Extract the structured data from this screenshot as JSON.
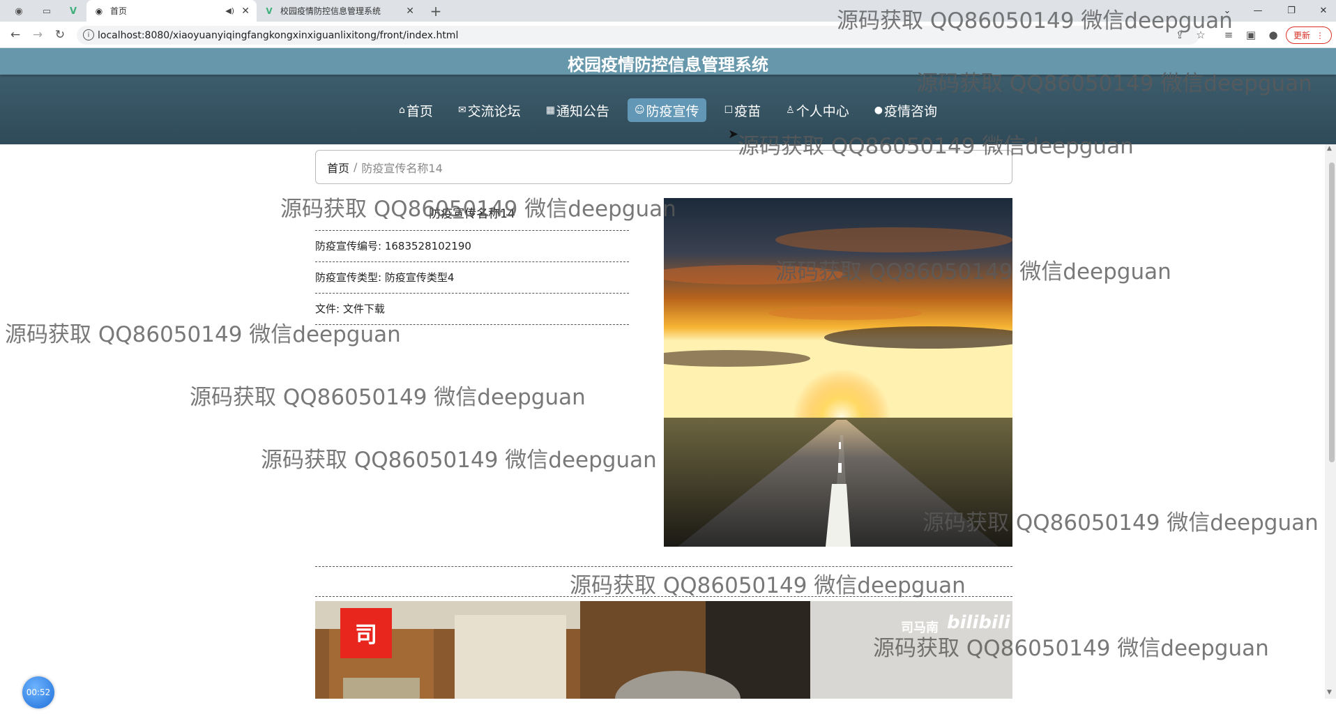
{
  "browser": {
    "tabs": [
      {
        "title": "首页",
        "active": true
      },
      {
        "title": "校园疫情防控信息管理系统",
        "active": false
      }
    ],
    "url": "localhost:8080/xiaoyuanyiqingfangkongxinxiguanlixitong/front/index.html",
    "update_label": "更新"
  },
  "site": {
    "title": "校园疫情防控信息管理系统",
    "menu": [
      {
        "icon": "⌂",
        "label": "首页"
      },
      {
        "icon": "✉",
        "label": "交流论坛"
      },
      {
        "icon": "▦",
        "label": "通知公告"
      },
      {
        "icon": "☺",
        "label": "防疫宣传",
        "active": true
      },
      {
        "icon": "☐",
        "label": "疫苗"
      },
      {
        "icon": "♙",
        "label": "个人中心"
      },
      {
        "icon": "●",
        "label": "疫情咨询"
      }
    ]
  },
  "breadcrumb": {
    "home": "首页",
    "separator": "/",
    "current": "防疫宣传名称14"
  },
  "detail": {
    "title": "防疫宣传名称14",
    "rows": [
      {
        "label": "防疫宣传编号:",
        "value": "1683528102190"
      },
      {
        "label": "防疫宣传类型:",
        "value": "防疫宣传类型4"
      },
      {
        "label": "文件:",
        "value": "文件下载"
      }
    ]
  },
  "video": {
    "channel_text": "司马南",
    "brand": "bilibili",
    "logo_char": "司"
  },
  "timer": "00:52",
  "watermark": "源码获取 QQ86050149 微信deepguan",
  "colors": {
    "header": "#3e5e6e",
    "title_strip": "#6797aa",
    "menu_active": "#6297b5"
  }
}
